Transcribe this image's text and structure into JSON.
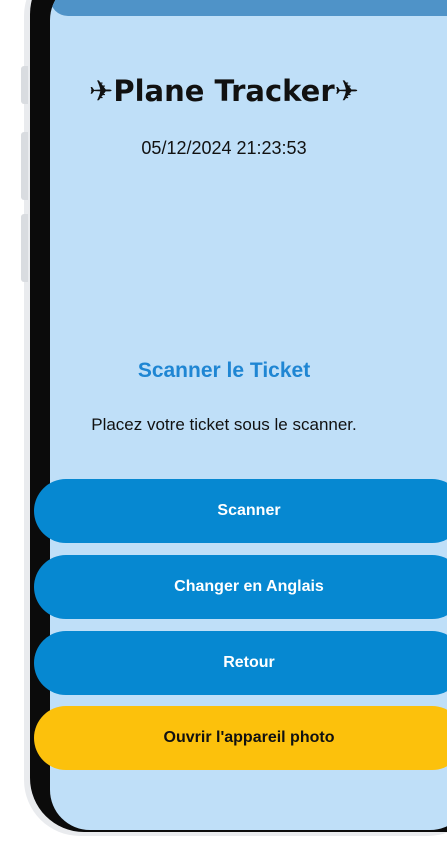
{
  "app": {
    "title_icon": "✈",
    "title_text": "Plane Tracker",
    "datetime": "05/12/2024 21:23:53"
  },
  "scan_section": {
    "heading": "Scanner le Ticket",
    "instructions": "Placez votre ticket sous le scanner."
  },
  "buttons": {
    "scan": "Scanner",
    "change_language": "Changer en Anglais",
    "back": "Retour",
    "open_camera": "Ouvrir l'appareil photo"
  },
  "colors": {
    "screen_background": "#bfdff8",
    "primary_button": "#0688d1",
    "camera_button": "#fcc10c",
    "heading_accent": "#1f86d3",
    "phone_frame": "#0b0b0b"
  }
}
